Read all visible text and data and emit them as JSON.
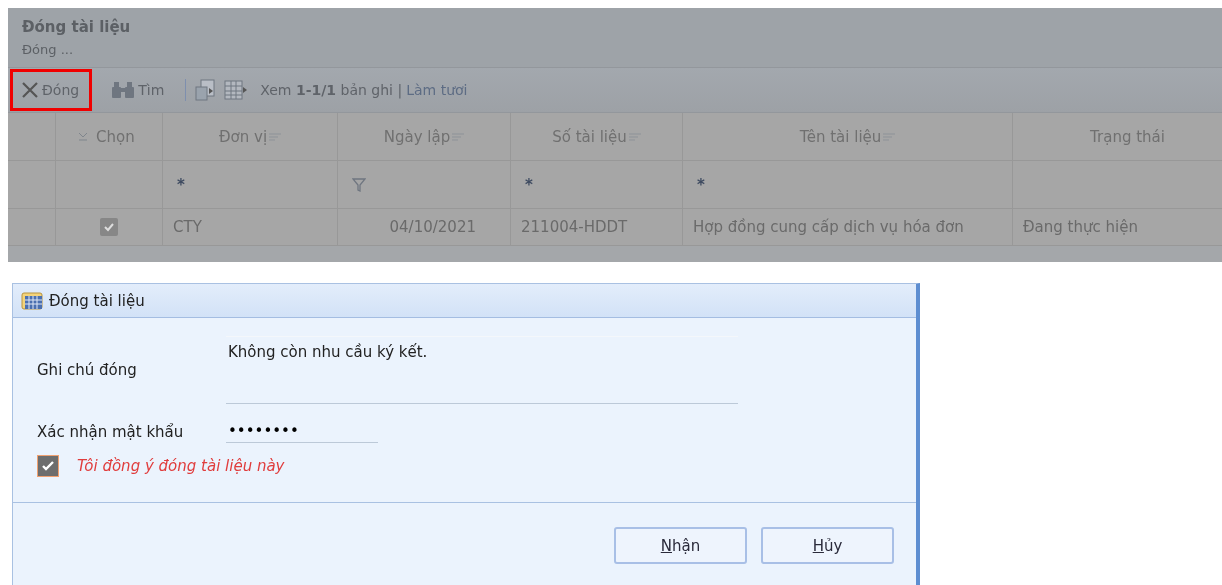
{
  "page": {
    "title": "Đóng tài liệu",
    "subtitle": "Đóng ..."
  },
  "toolbar": {
    "close_button": {
      "label": "Đóng",
      "highlighted": true
    },
    "find_button": {
      "label": "Tìm"
    },
    "view_prefix": "Xem",
    "range": "1-1/1",
    "view_suffix": "bản ghi |",
    "refresh_link": "Làm tươi"
  },
  "table": {
    "columns": [
      {
        "label": "Chọn",
        "kind": "check"
      },
      {
        "label": "Đơn vị",
        "kind": "sortable"
      },
      {
        "label": "Ngày lập",
        "kind": "sortable"
      },
      {
        "label": "Số tài liệu",
        "kind": "sortable"
      },
      {
        "label": "Tên tài liệu",
        "kind": "sortable"
      },
      {
        "label": "Trạng thái",
        "kind": "plain"
      }
    ],
    "filters": [
      {
        "kind": "none"
      },
      {
        "kind": "text",
        "value": "*"
      },
      {
        "kind": "funnel"
      },
      {
        "kind": "text",
        "value": "*"
      },
      {
        "kind": "text",
        "value": "*"
      },
      {
        "kind": "none"
      }
    ],
    "rows": [
      {
        "checked": true,
        "cells": [
          "",
          "CTY",
          "04/10/2021",
          "211004-HDDT",
          "Hợp đồng cung cấp dịch vụ hóa đơn",
          "Đang thực hiện"
        ]
      }
    ]
  },
  "dialog": {
    "title": "Đóng tài liệu",
    "note_label": "Ghi chú đóng",
    "note_value": "Không còn nhu cầu ký kết.",
    "password_label": "Xác nhận mật khẩu",
    "password_value": "••••••••",
    "agree": {
      "label": "Tôi đồng ý đóng tài liệu này",
      "checked": true
    },
    "buttons": [
      "Nhận",
      "Hủy"
    ]
  }
}
